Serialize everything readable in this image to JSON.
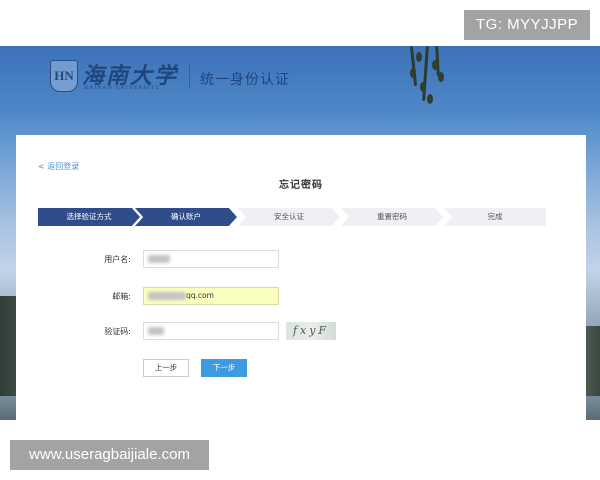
{
  "overlay": {
    "tg_badge": "TG: MYYJJPP",
    "watermark_url": "www.useragbaijiale.com"
  },
  "header": {
    "logo_letters": "HN",
    "university_name": "海南大学",
    "university_name_en": "HAINAN UNIVERSITY",
    "system_title": "统一身份认证"
  },
  "card": {
    "back_link": "< 返回登录",
    "title": "忘记密码",
    "steps": [
      {
        "label": "选择验证方式",
        "state": "active"
      },
      {
        "label": "确认账户",
        "state": "active"
      },
      {
        "label": "安全认证",
        "state": "inactive"
      },
      {
        "label": "重置密码",
        "state": "inactive"
      },
      {
        "label": "完成",
        "state": "inactive"
      }
    ],
    "form": {
      "username_label": "用户名:",
      "email_label": "邮箱:",
      "email_visible_suffix": "qq.com",
      "captcha_label": "验证码:",
      "captcha_text": "fxyF"
    },
    "buttons": {
      "prev": "上一步",
      "next": "下一步"
    }
  },
  "colors": {
    "step_active": "#2f4d8a",
    "step_inactive": "#eef0f4",
    "primary_button": "#3d9be0",
    "link": "#4a90d9",
    "autofill_bg": "#faffbd"
  }
}
